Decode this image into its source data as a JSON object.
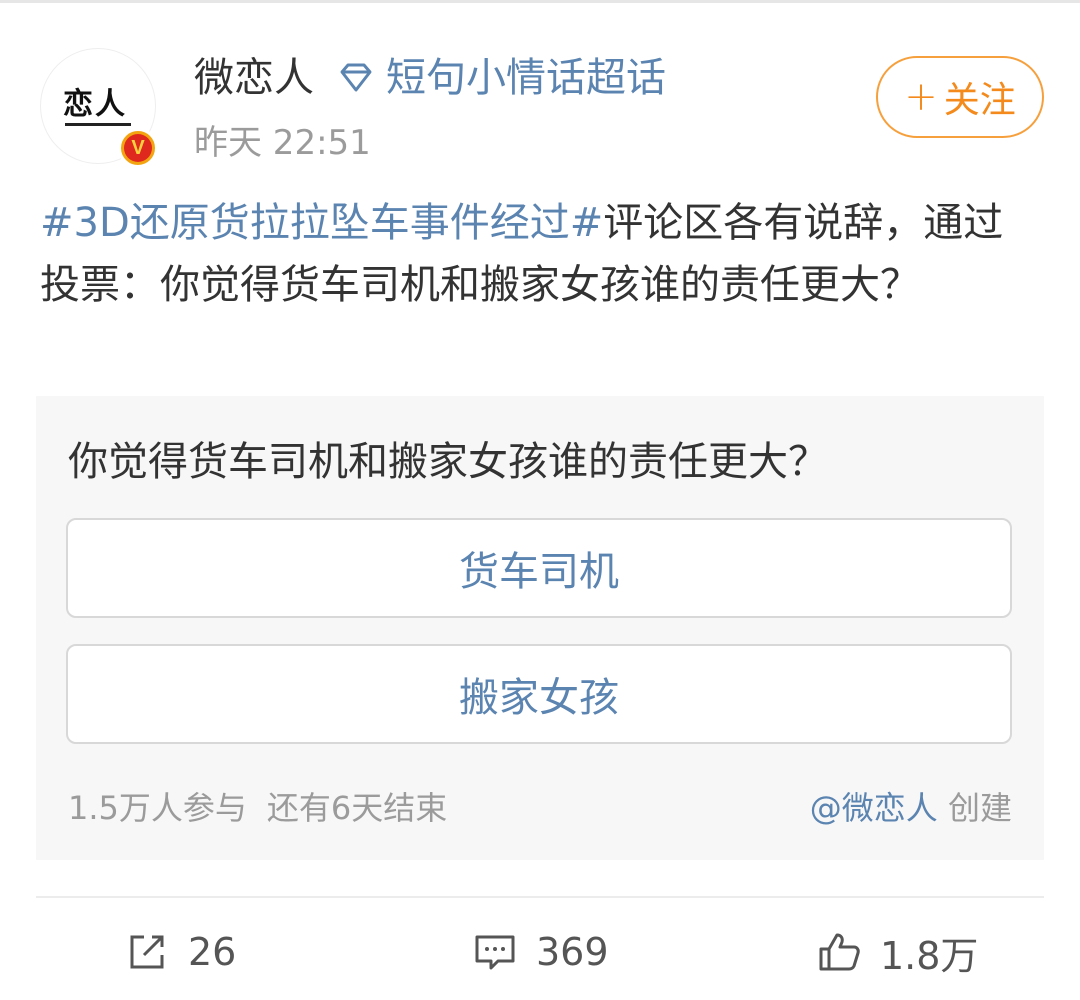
{
  "header": {
    "username": "微恋人",
    "supertopic": "短句小情话超话",
    "time": "昨天 22:51",
    "follow_label": "关注",
    "avatar_text": "恋人",
    "verified_badge": "V"
  },
  "post": {
    "hashtag": "#3D还原货拉拉坠车事件经过#",
    "text": "评论区各有说辞，通过投票：你觉得货车司机和搬家女孩谁的责任更大？"
  },
  "poll": {
    "question": "你觉得货车司机和搬家女孩谁的责任更大？",
    "options": [
      "货车司机",
      "搬家女孩"
    ],
    "participants": "1.5万人参与",
    "remaining": "还有6天结束",
    "creator": "@微恋人",
    "creator_suffix": "创建"
  },
  "actions": {
    "share_count": "26",
    "comment_count": "369",
    "like_count": "1.8万"
  },
  "colors": {
    "link": "#5b84b1",
    "follow": "#f38a1b",
    "muted": "#9b9b9b",
    "badge": "#e0291e"
  },
  "icons": [
    "diamond-icon",
    "share-icon",
    "comment-icon",
    "like-icon"
  ]
}
